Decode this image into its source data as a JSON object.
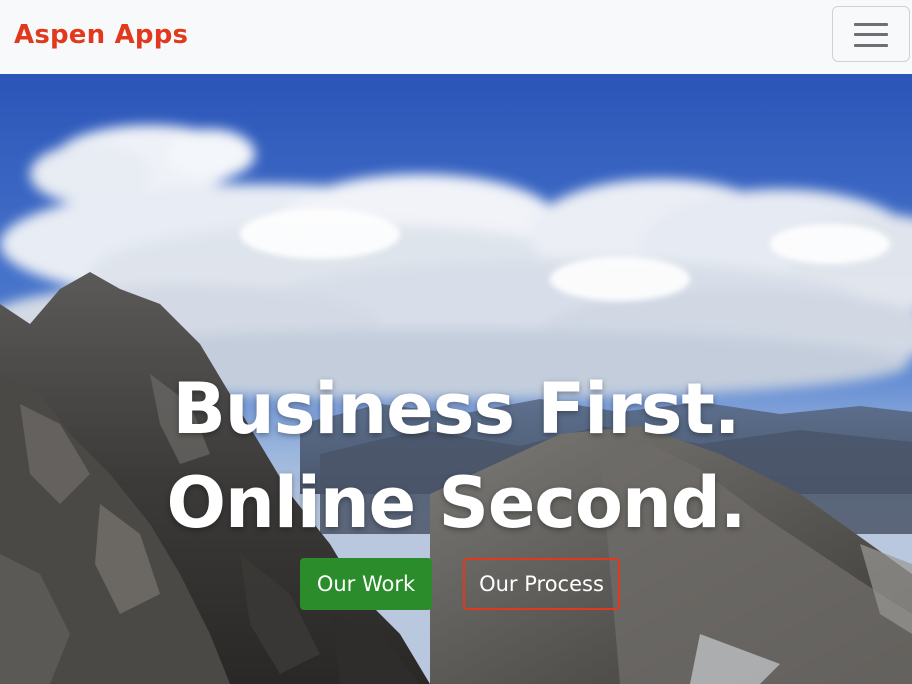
{
  "navbar": {
    "brand": "Aspen Apps",
    "toggler_icon": "hamburger-menu-icon",
    "brand_color": "#e0391d",
    "background_color": "#f8f9fa"
  },
  "hero": {
    "headline_line1": "Business First.",
    "headline_line2": "Online Second.",
    "background": "mountain-peak-with-clouds-photo",
    "buttons": {
      "work_label": "Our Work",
      "process_label": "Our Process"
    },
    "colors": {
      "work_button": "#2a8c2a",
      "process_border": "#e0391d",
      "text": "#ffffff"
    }
  }
}
